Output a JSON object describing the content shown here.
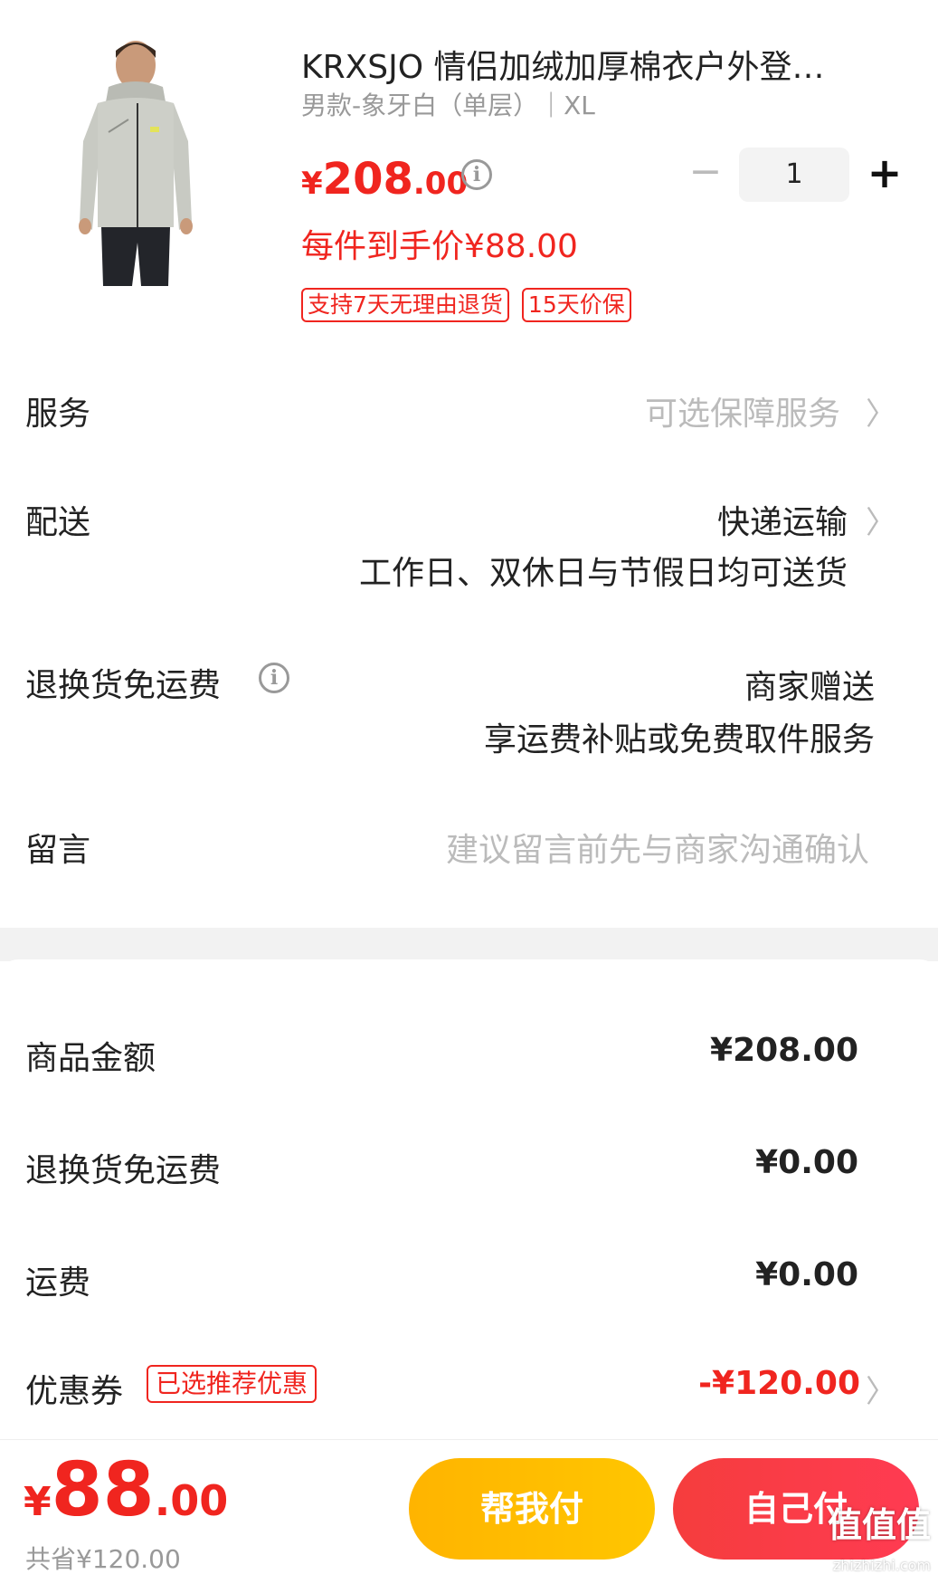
{
  "product": {
    "title": "KRXSJO 情侣加绒加厚棉衣户外登…",
    "sku": "男款-象牙白（单层）｜XL",
    "price_symbol": "¥",
    "price_int": "208",
    "price_dec": ".00",
    "quantity": "1",
    "final_price": "每件到手价¥88.00",
    "tags": [
      "支持7天无理由退货",
      "15天价保"
    ]
  },
  "service": {
    "label": "服务",
    "value": "可选保障服务"
  },
  "delivery": {
    "label": "配送",
    "value": "快递运输",
    "note": "工作日、双休日与节假日均可送货"
  },
  "return_shipping": {
    "label": "退换货免运费",
    "value": "商家赠送",
    "note": "享运费补贴或免费取件服务"
  },
  "message": {
    "label": "留言",
    "placeholder": "建议留言前先与商家沟通确认"
  },
  "summary": {
    "goods_label": "商品金额",
    "goods_value": "¥208.00",
    "return_label": "退换货免运费",
    "return_value": "¥0.00",
    "freight_label": "运费",
    "freight_value": "¥0.00",
    "coupon_label": "优惠券",
    "coupon_tag": "已选推荐优惠",
    "coupon_value": "-¥120.00"
  },
  "bottom": {
    "total_symbol": "¥",
    "total_int": "88",
    "total_dec": ".00",
    "saved": "共省¥120.00",
    "help_pay": "帮我付",
    "self_pay": "自己付"
  },
  "watermark": {
    "main": "值值值",
    "sub": "zhizhizhi.com"
  },
  "colors": {
    "accent_red": "#f0251f",
    "help_button": "#ffbb00",
    "self_button": "#f53d3d"
  }
}
